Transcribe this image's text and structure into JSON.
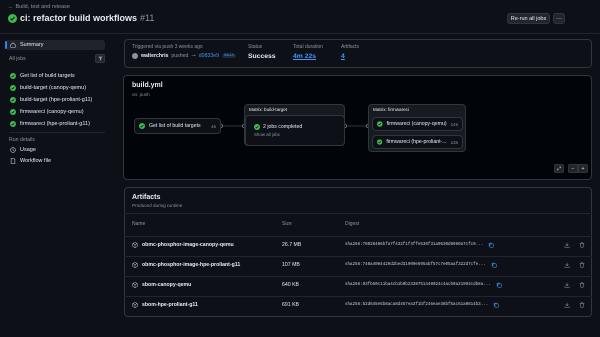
{
  "header": {
    "back_label": "Build, test and release",
    "title": "ci: refactor build workflows",
    "run_number": "#11",
    "rerun_label": "Re-run all jobs",
    "more_label": "···"
  },
  "sidebar": {
    "summary_label": "Summary",
    "all_jobs_label": "All jobs",
    "jobs": [
      {
        "label": "Get list of build targets"
      },
      {
        "label": "build-target (canopy-qemu)"
      },
      {
        "label": "build-target (hpe-proliant-g11)"
      },
      {
        "label": "firmwareci (canopy-qemu)"
      },
      {
        "label": "firmwareci (hpe-proliant-g11)"
      }
    ],
    "run_details_label": "Run details",
    "usage_label": "Usage",
    "workflow_file_label": "Workflow file"
  },
  "summary": {
    "trigger_label": "Triggered via push 3 weeks ago",
    "user": "walterchris",
    "pushed_label": "pushed",
    "sha": "d0833e9",
    "branch": "main",
    "status_label": "Status",
    "status_value": "Success",
    "duration_label": "Total duration",
    "duration_value": "4m 22s",
    "artifacts_label": "Artifacts",
    "artifacts_value": "4"
  },
  "graph": {
    "file": "build.yml",
    "trigger": "on: push",
    "job1": {
      "label": "Get list of build targets",
      "duration": "4s"
    },
    "matrix1": {
      "title": "Matrix: build-target",
      "summary": "2 jobs completed",
      "show_all": "Show all jobs"
    },
    "matrix2": {
      "title": "Matrix: firmwareci",
      "jobs": [
        {
          "label": "firmwareci (canopy-qemu)",
          "duration": "14s"
        },
        {
          "label": "firmwareci (hpe-proliant-...",
          "duration": "13s"
        }
      ]
    },
    "zoom_fit": "⤢",
    "zoom_out": "−",
    "zoom_in": "+"
  },
  "artifacts": {
    "title": "Artifacts",
    "subtitle": "Produced during runtime",
    "columns": {
      "name": "Name",
      "size": "Size",
      "digest": "Digest"
    },
    "rows": [
      {
        "name": "obmc-phosphor-image-canopy-qemu",
        "size": "26.7 MB",
        "digest": "sha256:78028486bfa7f432f1f4ffe536f31a0530d8060a7cfc9..."
      },
      {
        "name": "obmc-phosphor-image-hpe-proliant-g11",
        "size": "107 MB",
        "digest": "sha256:748a4084429d2bed31900e695abf57c7e05aaf322d7cfe..."
      },
      {
        "name": "sbom-canopy-qemu",
        "size": "640 KB",
        "digest": "sha256:83fb50c11ba4cb1b9b2338751448024c4acb0a21993cdb8a..."
      },
      {
        "name": "sbom-hpe-proliant-g11",
        "size": "691 KB",
        "digest": "sha256:52d645e5b8aca8d457ea3f1bf246eae36bf5ac61a0814b3..."
      }
    ]
  },
  "colors": {
    "success": "#3fb950",
    "link": "#4493f8",
    "background": "#0d1117",
    "border": "#30363d"
  }
}
